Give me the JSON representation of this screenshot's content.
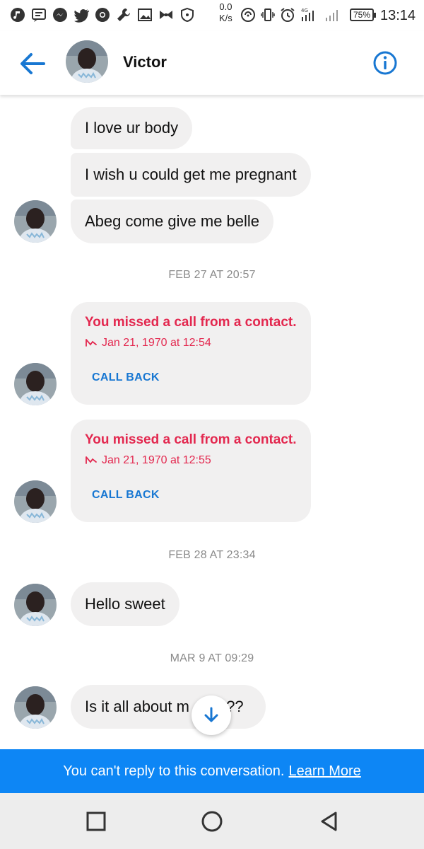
{
  "status_bar": {
    "net_speed_value": "0.0",
    "net_speed_unit": "K/s",
    "battery": "75%",
    "time": "13:14",
    "icons": [
      "music-icon",
      "message-icon",
      "messenger-icon",
      "twitter-icon",
      "chrome-icon",
      "wrench-icon",
      "gallery-icon",
      "bowtie-icon",
      "shield-icon",
      "nfc-icon",
      "vibrate-icon",
      "alarm-icon",
      "signal-4g-icon",
      "signal-icon"
    ]
  },
  "header": {
    "contact_name": "Victor",
    "back_icon": "arrow-left-icon",
    "info_icon": "info-icon",
    "accent_color": "#1877d2"
  },
  "messages": [
    {
      "type": "text",
      "text": "I love ur body"
    },
    {
      "type": "text",
      "text": "I wish u could get me pregnant"
    },
    {
      "type": "text",
      "text": "Abeg come give me belle"
    },
    {
      "type": "date",
      "text": "FEB 27 AT 20:57"
    },
    {
      "type": "missed_call",
      "title": "You missed a call from a contact.",
      "time": "Jan 21, 1970 at 12:54",
      "action": "CALL BACK"
    },
    {
      "type": "missed_call",
      "title": "You missed a call from a contact.",
      "time": "Jan 21, 1970 at 12:55",
      "action": "CALL BACK"
    },
    {
      "type": "date",
      "text": "FEB 28 AT 23:34"
    },
    {
      "type": "text",
      "text": "Hello sweet"
    },
    {
      "type": "date",
      "text": "MAR 9 AT 09:29"
    },
    {
      "type": "text",
      "text_left": "Is it all about m",
      "text_right": "???"
    }
  ],
  "banner": {
    "text": "You can't reply to this conversation.",
    "link": "Learn More",
    "color": "#0d86f5"
  },
  "colors": {
    "bubble": "#f1f0f0",
    "missed": "#e3284f",
    "link": "#1877d2"
  }
}
